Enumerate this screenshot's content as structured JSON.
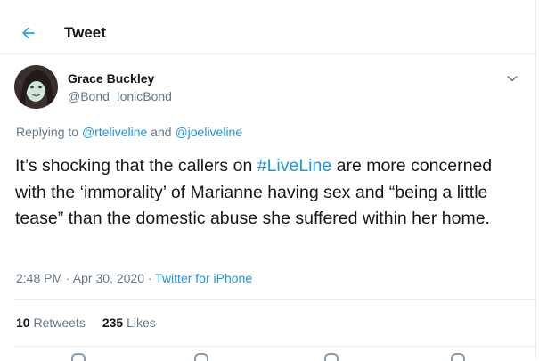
{
  "header": {
    "title": "Tweet",
    "back_icon": "back-arrow-icon"
  },
  "tweet": {
    "author_name": "Grace Buckley",
    "author_handle": "@Bond_IonicBond",
    "replying_prefix": "Replying to ",
    "reply_to_1": "@rteliveline",
    "reply_and": " and ",
    "reply_to_2": "@joeliveline",
    "text_1": "It’s shocking that the callers on ",
    "hashtag": "#LiveLine",
    "text_2": " are more concerned with the ‘immorality’ of Marianne having sex and “being a little tease” than the domestic abuse she suffered within her home.",
    "time": "2:48 PM · Apr 30, 2020 · ",
    "source": "Twitter for iPhone",
    "retweets_count": "10",
    "retweets_label": " Retweets",
    "likes_count": "235",
    "likes_label": " Likes"
  },
  "colors": {
    "link": "#1b95e0",
    "muted": "#657786",
    "text": "#14171a",
    "border": "#e6ecf0"
  }
}
